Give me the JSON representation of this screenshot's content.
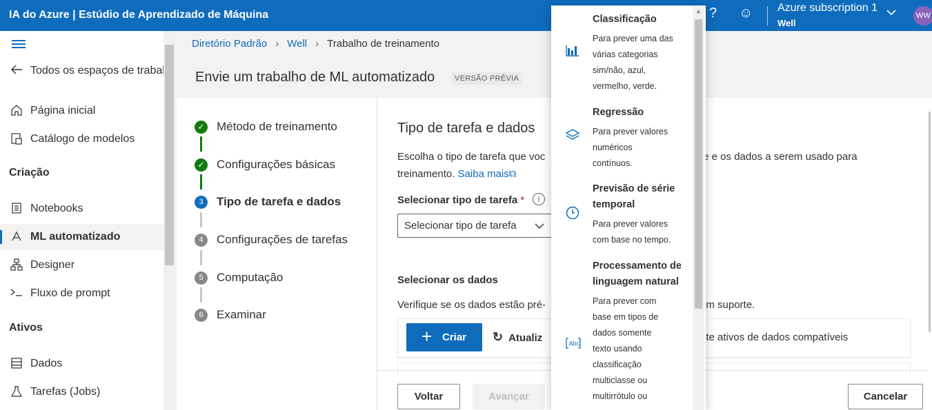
{
  "topbar": {
    "title": "IA do Azure | Estúdio de Aprendizado de Máquina",
    "help_icon": "?",
    "subscription": "Azure subscription 1",
    "directory": "Well",
    "avatar": "WW"
  },
  "nav": {
    "back_label": "Todos os espaços de trabal",
    "home": "Página inicial",
    "model_catalog": "Catálogo de modelos",
    "section_create": "Criação",
    "notebooks": "Notebooks",
    "automl": "ML automatizado",
    "designer": "Designer",
    "prompt_flow": "Fluxo de prompt",
    "section_assets": "Ativos",
    "data": "Dados",
    "jobs": "Tarefas (Jobs)"
  },
  "breadcrumb": {
    "item1": "Diretório Padrão",
    "item2": "Well",
    "item3": "Trabalho de treinamento"
  },
  "page": {
    "title": "Envie um trabalho de ML automatizado",
    "badge": "VERSÃO PRÉVIA"
  },
  "steps": [
    {
      "num": "✓",
      "label": "Método de treinamento",
      "state": "done"
    },
    {
      "num": "✓",
      "label": "Configurações básicas",
      "state": "done"
    },
    {
      "num": "3",
      "label": "Tipo de tarefa e dados",
      "state": "current"
    },
    {
      "num": "4",
      "label": "Configurações de tarefas",
      "state": "todo"
    },
    {
      "num": "5",
      "label": "Computação",
      "state": "todo"
    },
    {
      "num": "6",
      "label": "Examinar",
      "state": "todo"
    }
  ],
  "section": {
    "title": "Tipo de tarefa e dados",
    "desc_line1_left": "Escolha o tipo de tarefa que voc",
    "desc_line1_right": "te e os dados a serem usado para",
    "desc_line2": "treinamento.",
    "learn_more": "Saiba mais",
    "task_label": "Selecionar tipo de tarefa",
    "required": "*",
    "info_icon": "i",
    "task_placeholder": "Selecionar tipo de tarefa",
    "data_title": "Selecionar os dados",
    "data_desc_left": "Verifique se os dados estão pré-",
    "data_desc_right": "om suporte.",
    "create_label": "Criar",
    "refresh_label": "Atualiz",
    "compat_text": "nte ativos de dados compatíveis"
  },
  "footer": {
    "back": "Voltar",
    "next": "Avançar",
    "cancel": "Cancelar"
  },
  "dropdown": {
    "options": [
      {
        "title": "Classificação",
        "desc": [
          "Para prever uma das",
          "várias categorias",
          "sim/não, azul,",
          "vermelho, verde."
        ],
        "icon": "bar-chart-icon"
      },
      {
        "title": "Regressão",
        "desc": [
          "Para prever valores",
          "numéricos",
          "contínuos."
        ],
        "icon": "layers-icon"
      },
      {
        "title_lines": [
          "Previsão de série",
          "temporal"
        ],
        "desc": [
          "Para prever valores",
          "com base no tempo."
        ],
        "icon": "clock-icon"
      },
      {
        "title_lines": [
          "Processamento de",
          "linguagem natural"
        ],
        "desc": [
          "Para prever com",
          "base em tipos de",
          "dados somente",
          "texto usando",
          "classificação",
          "multiclasse ou",
          "multirrótulo ou"
        ],
        "icon": "text-abc-icon"
      }
    ]
  },
  "colors": {
    "brand": "#0f6cbd",
    "success": "#107c10",
    "required": "#a4262c"
  }
}
